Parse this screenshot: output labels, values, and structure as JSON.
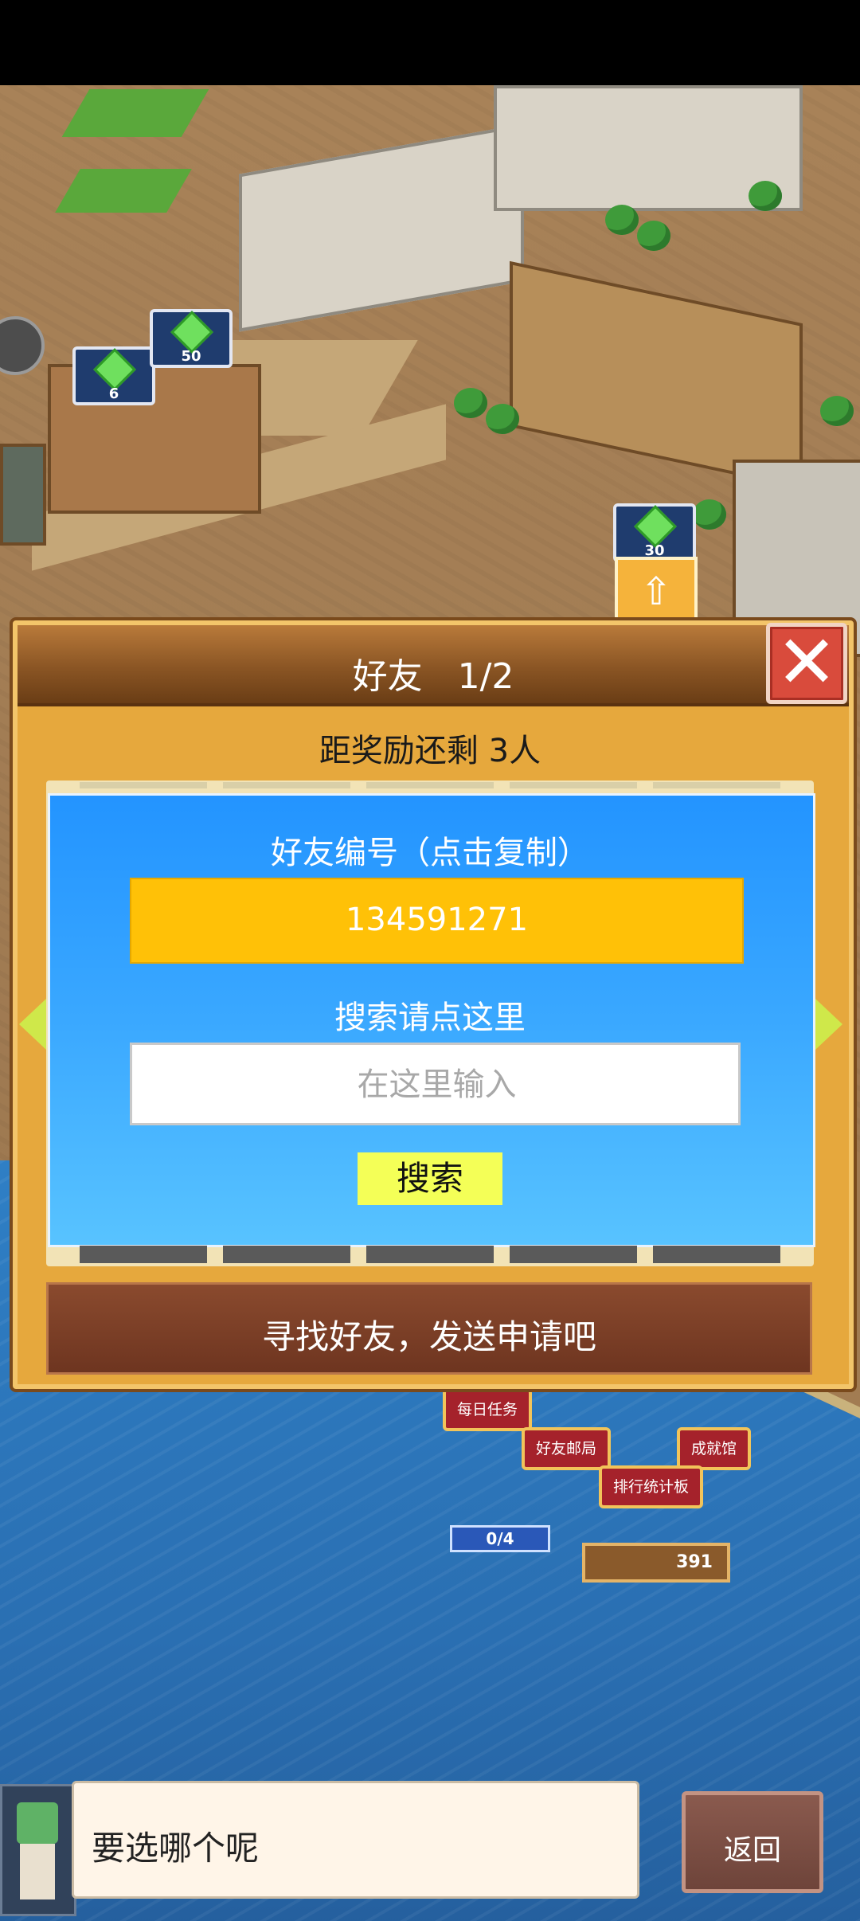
{
  "dialog": {
    "title": "好友　1/2",
    "close_icon": "close-icon",
    "reward_text": "距奖励还剩 3人",
    "friend_id_label": "好友编号（点击复制）",
    "friend_id_value": "134591271",
    "search_label": "搜索请点这里",
    "search_placeholder": "在这里输入",
    "search_button": "搜索",
    "find_friends_text": "寻找好友，发送申请吧"
  },
  "map": {
    "gem_badges": [
      "6",
      "50",
      "30"
    ],
    "labels": {
      "daily_tasks": "每日任务",
      "friend_mail": "好友邮局",
      "achievements": "成就馆",
      "leaderboard": "排行统计板"
    },
    "counter": "0/4",
    "sign_value": "391"
  },
  "bottom": {
    "speech_text": "要选哪个呢",
    "back_button": "返回"
  },
  "colors": {
    "friend_id_box": "#ffc107",
    "panel_blue": "#2394ff",
    "close_red": "#d94b3c",
    "search_button": "#f4ff57"
  }
}
